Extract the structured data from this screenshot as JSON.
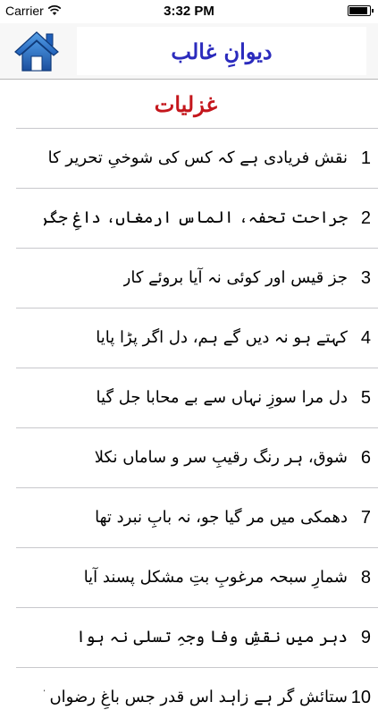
{
  "status_bar": {
    "carrier": "Carrier",
    "time": "3:32 PM",
    "battery_level": 0.95
  },
  "nav": {
    "title": "دیوانِ غالب",
    "home_icon": "home-icon"
  },
  "section": {
    "title": "غزلیات"
  },
  "items": [
    {
      "num": "1",
      "text": "نقش فریادی ہے کہ کس کی شوخیِ تحریر کا"
    },
    {
      "num": "2",
      "text": "جراحت تحفہ، الماس ارمغاں، داغِ جگر ہدیہ"
    },
    {
      "num": "3",
      "text": "جز قیس اور کوئی نہ آیا بروئے کار"
    },
    {
      "num": "4",
      "text": "کہتے ہو نہ دیں گے ہم، دل اگر پڑا پایا"
    },
    {
      "num": "5",
      "text": "دل مرا سوزِ نہاں سے بے محابا جل گیا"
    },
    {
      "num": "6",
      "text": "شوق، ہر رنگ رقیبِ سر و ساماں نکلا"
    },
    {
      "num": "7",
      "text": "دھمکی میں مر گیا جو، نہ بابِ نبرد تھا"
    },
    {
      "num": "8",
      "text": "شمارِ سبحہ مرغوبِ بتِ مشکل پسند آیا"
    },
    {
      "num": "9",
      "text": "دہر میں نقشِ وفا وجہِ تسلی نہ ہوا"
    },
    {
      "num": "10",
      "text": "ستائش گر ہے زاہد اس قدر جس باغِ رضواں کا"
    }
  ]
}
